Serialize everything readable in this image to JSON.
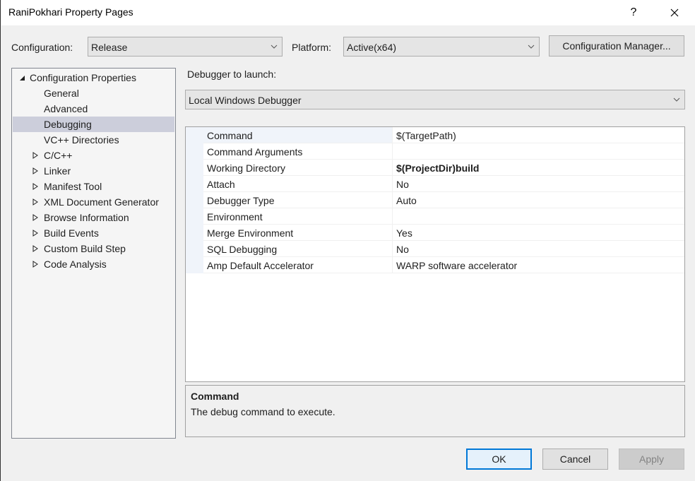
{
  "window": {
    "title": "RaniPokhari Property Pages",
    "help_label": "?",
    "close_icon": "close-icon"
  },
  "toolbar": {
    "configuration_label": "Configuration:",
    "configuration_value": "Release",
    "platform_label": "Platform:",
    "platform_value": "Active(x64)",
    "config_manager_label": "Configuration Manager..."
  },
  "tree": {
    "root": {
      "label": "Configuration Properties",
      "expanded": true
    },
    "items": [
      {
        "label": "General",
        "expandable": false,
        "selected": false
      },
      {
        "label": "Advanced",
        "expandable": false,
        "selected": false
      },
      {
        "label": "Debugging",
        "expandable": false,
        "selected": true
      },
      {
        "label": "VC++ Directories",
        "expandable": false,
        "selected": false
      },
      {
        "label": "C/C++",
        "expandable": true,
        "selected": false
      },
      {
        "label": "Linker",
        "expandable": true,
        "selected": false
      },
      {
        "label": "Manifest Tool",
        "expandable": true,
        "selected": false
      },
      {
        "label": "XML Document Generator",
        "expandable": true,
        "selected": false
      },
      {
        "label": "Browse Information",
        "expandable": true,
        "selected": false
      },
      {
        "label": "Build Events",
        "expandable": true,
        "selected": false
      },
      {
        "label": "Custom Build Step",
        "expandable": true,
        "selected": false
      },
      {
        "label": "Code Analysis",
        "expandable": true,
        "selected": false
      }
    ]
  },
  "debugger": {
    "label": "Debugger to launch:",
    "value": "Local Windows Debugger"
  },
  "properties": [
    {
      "name": "Command",
      "value": "$(TargetPath)",
      "bold": false
    },
    {
      "name": "Command Arguments",
      "value": "",
      "bold": false
    },
    {
      "name": "Working Directory",
      "value": "$(ProjectDir)build",
      "bold": true
    },
    {
      "name": "Attach",
      "value": "No",
      "bold": false
    },
    {
      "name": "Debugger Type",
      "value": "Auto",
      "bold": false
    },
    {
      "name": "Environment",
      "value": "",
      "bold": false
    },
    {
      "name": "Merge Environment",
      "value": "Yes",
      "bold": false
    },
    {
      "name": "SQL Debugging",
      "value": "No",
      "bold": false
    },
    {
      "name": "Amp Default Accelerator",
      "value": "WARP software accelerator",
      "bold": false
    }
  ],
  "description": {
    "title": "Command",
    "text": "The debug command to execute."
  },
  "buttons": {
    "ok": "OK",
    "cancel": "Cancel",
    "apply": "Apply"
  }
}
